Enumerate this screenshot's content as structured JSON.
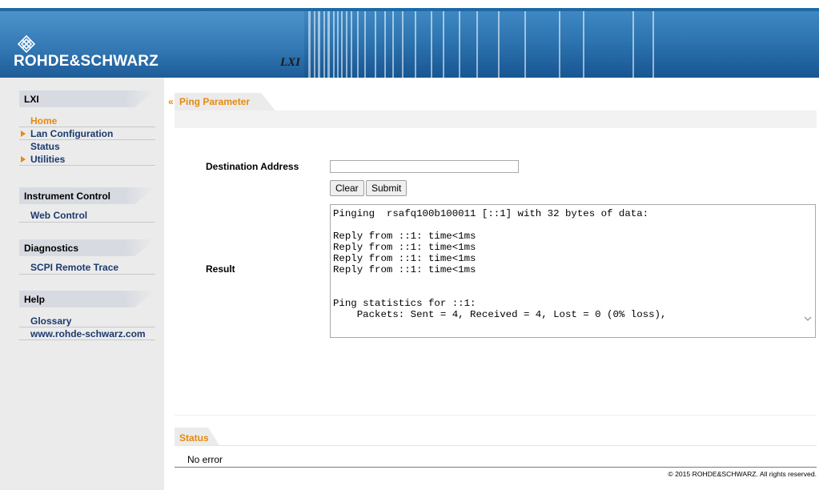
{
  "header": {
    "brand": "ROHDE&SCHWARZ",
    "lxi_logo": "LXI",
    "colors": {
      "band_top": "#3e88c3",
      "band_bottom": "#175692"
    }
  },
  "sidebar": {
    "sections": [
      {
        "title": "LXI",
        "items": [
          {
            "label": "Home",
            "active": true,
            "expandable": false
          },
          {
            "label": "Lan Configuration",
            "active": false,
            "expandable": true
          },
          {
            "label": "Status",
            "active": false,
            "expandable": false
          },
          {
            "label": "Utilities",
            "active": false,
            "expandable": true
          }
        ]
      },
      {
        "title": "Instrument Control",
        "items": [
          {
            "label": "Web Control",
            "active": false,
            "expandable": false
          }
        ]
      },
      {
        "title": "Diagnostics",
        "items": [
          {
            "label": "SCPI Remote Trace",
            "active": false,
            "expandable": false
          }
        ]
      },
      {
        "title": "Help",
        "items": [
          {
            "label": "Glossary",
            "active": false,
            "expandable": false
          },
          {
            "label": "www.rohde-schwarz.com",
            "active": false,
            "expandable": false
          }
        ]
      }
    ],
    "accent_color": "#e9890c",
    "link_color": "#1b3a6e"
  },
  "main": {
    "tab_chevron": "«",
    "tab_label": "Ping Parameter",
    "destination_label": "Destination Address",
    "destination_value": "",
    "clear_label": "Clear",
    "submit_label": "Submit",
    "result_label": "Result",
    "result_text": "Pinging  rsafq100b100011 [::1] with 32 bytes of data:\n\nReply from ::1: time<1ms\nReply from ::1: time<1ms\nReply from ::1: time<1ms\nReply from ::1: time<1ms\n\n\nPing statistics for ::1:\n    Packets: Sent = 4, Received = 4, Lost = 0 (0% loss),"
  },
  "status": {
    "tab_label": "Status",
    "message": "No error"
  },
  "footer": {
    "copyright": "© 2015 ROHDE&SCHWARZ. All rights reserved."
  }
}
